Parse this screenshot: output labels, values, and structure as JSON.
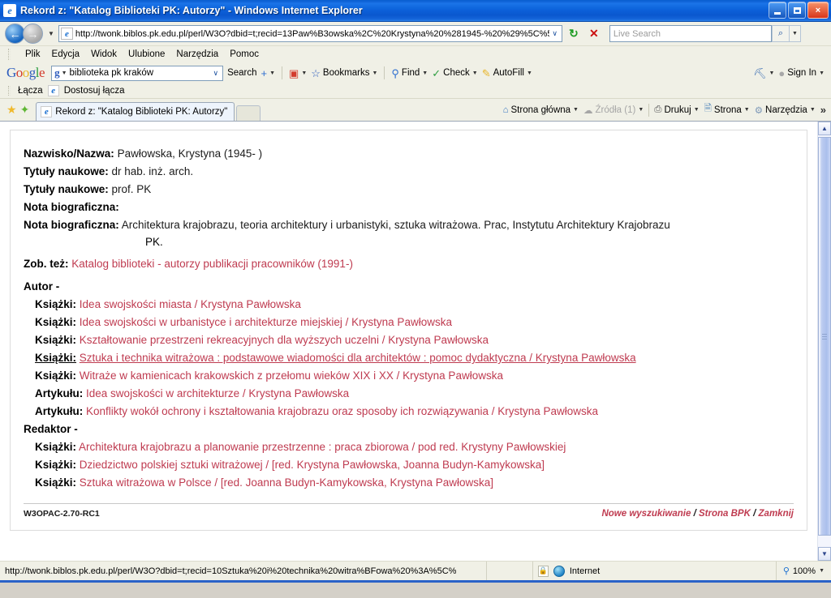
{
  "window": {
    "title": "Rekord z: \"Katalog Biblioteki PK: Autorzy\" - Windows Internet Explorer",
    "app_icon": "ie-icon",
    "minimize_label": "minimize-button",
    "maximize_label": "maximize-button",
    "close_label": "×"
  },
  "address_bar": {
    "back_glyph": "←",
    "forward_glyph": "→",
    "history_caret": "▼",
    "url": "http://twonk.biblos.pk.edu.pl/perl/W3O?dbid=t;recid=13Paw%B3owska%2C%20Krystyna%20%281945-%20%29%5C%5",
    "url_icon": "e",
    "url_dropdown_caret": "∨",
    "refresh_glyph": "↻",
    "stop_glyph": "✕",
    "search_placeholder": "Live Search",
    "search_go_glyph": "⌕",
    "search_dropdown_caret": "▼"
  },
  "menubar": {
    "items": [
      {
        "label": "Plik",
        "accel": "P"
      },
      {
        "label": "Edycja",
        "accel": "E"
      },
      {
        "label": "Widok",
        "accel": "W"
      },
      {
        "label": "Ulubione",
        "accel": "U"
      },
      {
        "label": "Narzędzia",
        "accel": "N"
      },
      {
        "label": "Pomoc",
        "accel": "c"
      }
    ]
  },
  "google_toolbar": {
    "logo_letters": [
      "G",
      "o",
      "o",
      "g",
      "l",
      "e"
    ],
    "search_value": "biblioteka pk kraków",
    "search_gmark": "g",
    "search_caret": "▼",
    "search_dropdown_caret": "∨",
    "search_button_label": "Search",
    "plus_label": "+",
    "bookmarks_label": "Bookmarks",
    "find_label": "Find",
    "check_label": "Check",
    "autofill_label": "AutoFill",
    "settings_label": "wrench-icon",
    "signin_label": "Sign In",
    "caret": "▼"
  },
  "links_bar": {
    "label": "Łącza",
    "item": "Dostosuj łącza"
  },
  "tab_bar": {
    "favorites_star": "★",
    "add_to_favorites": "✦",
    "tab_label": "Rekord z: \"Katalog Biblioteki PK: Autorzy\"",
    "right_items": [
      {
        "label": "Strona główna",
        "icon": "home-icon",
        "disabled": false
      },
      {
        "label": "Źródła (1)",
        "icon": "rss-icon",
        "disabled": true
      },
      {
        "label": "Drukuj",
        "icon": "printer-icon",
        "disabled": false
      },
      {
        "label": "Strona",
        "icon": "page-icon",
        "disabled": false
      },
      {
        "label": "Narzędzia",
        "icon": "gear-icon",
        "disabled": false
      }
    ],
    "overflow_glyph": "»"
  },
  "record": {
    "fields": [
      {
        "label": "Nazwisko/Nazwa:",
        "value": "Pawłowska, Krystyna (1945- )"
      },
      {
        "label": "Tytuły naukowe:",
        "value": "dr hab. inż. arch."
      },
      {
        "label": "Tytuły naukowe:",
        "value": "prof. PK"
      },
      {
        "label": "Nota biograficzna:",
        "value": ""
      }
    ],
    "bio_label": "Nota biograficzna:",
    "bio_value": "Architektura krajobrazu, teoria architektury i urbanistyki, sztuka witrażowa. Prac, Instytutu Architektury Krajobrazu",
    "bio_value_cont": "PK.",
    "see_also_label": "Zob. też:",
    "see_also_link": "Katalog biblioteki - autorzy publikacji pracowników (1991-)",
    "author_section": "Autor -",
    "author_entries": [
      {
        "label": "Książki:",
        "link": "Idea swojskości miasta / Krystyna Pawłowska",
        "hover": false
      },
      {
        "label": "Książki:",
        "link": "Idea swojskości w urbanistyce i architekturze miejskiej / Krystyna Pawłowska",
        "hover": false
      },
      {
        "label": "Książki:",
        "link": "Kształtowanie przestrzeni rekreacyjnych dla wyższych uczelni / Krystyna Pawłowska",
        "hover": false
      },
      {
        "label": "Książki:",
        "link": "Sztuka i technika witrażowa : podstawowe wiadomości dla architektów : pomoc dydaktyczna / Krystyna Pawłowska",
        "hover": true
      },
      {
        "label": "Książki:",
        "link": "Witraże w kamienicach krakowskich z przełomu wieków XIX i XX / Krystyna Pawłowska",
        "hover": false
      },
      {
        "label": "Artykułu:",
        "link": "Idea swojskości w architekturze / Krystyna Pawłowska",
        "hover": false
      },
      {
        "label": "Artykułu:",
        "link": "Konflikty wokół ochrony i kształtowania krajobrazu oraz sposoby ich rozwiązywania / Krystyna Pawłowska",
        "hover": false
      }
    ],
    "editor_section": "Redaktor -",
    "editor_entries": [
      {
        "label": "Książki:",
        "link": "Architektura krajobrazu a planowanie przestrzenne : praca zbiorowa / pod red. Krystyny Pawłowskiej",
        "hover": false
      },
      {
        "label": "Książki:",
        "link": "Dziedzictwo polskiej sztuki witrażowej / [red. Krystyna Pawłowska, Joanna Budyn-Kamykowska]",
        "hover": false
      },
      {
        "label": "Książki:",
        "link": "Sztuka witrażowa w Polsce / [red. Joanna Budyn-Kamykowska, Krystyna Pawłowska]",
        "hover": false
      }
    ],
    "footer_version": "W3OPAC-2.70-RC1",
    "footer_links": [
      {
        "label": "Nowe wyszukiwanie"
      },
      {
        "label": "Strona BPK"
      },
      {
        "label": "Zamknij"
      }
    ],
    "footer_separator": "/"
  },
  "scrollbar": {
    "up_glyph": "▲",
    "down_glyph": "▼"
  },
  "status_bar": {
    "url": "http://twonk.biblos.pk.edu.pl/perl/W3O?dbid=t;recid=10Sztuka%20i%20technika%20witra%BFowa%20%3A%5C%",
    "zone": "Internet",
    "zoom": "100%",
    "zoom_caret": "▼"
  },
  "colors": {
    "link": "#bf3b50",
    "titlebar": "#0d62d6",
    "chrome": "#f0f0e6"
  }
}
